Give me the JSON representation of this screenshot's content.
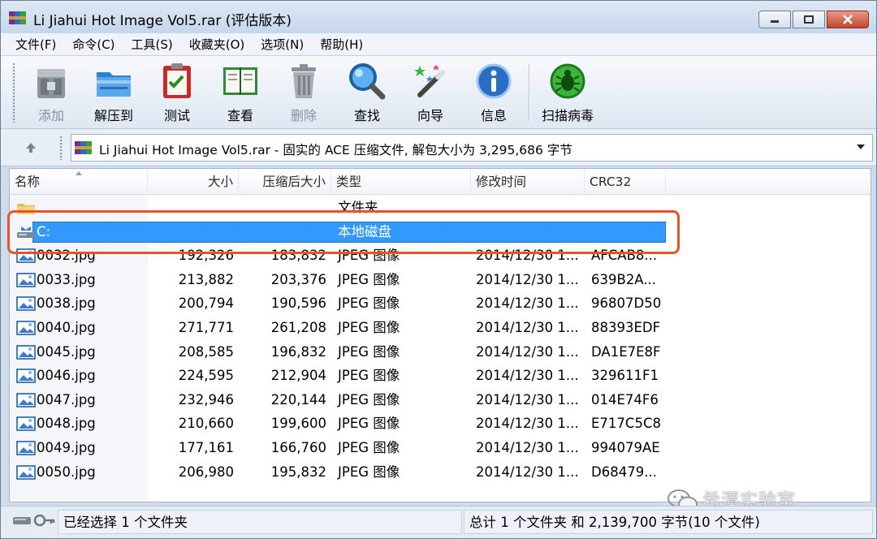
{
  "window": {
    "title": "Li Jiahui Hot Image Vol5.rar (评估版本)",
    "controls": {
      "minimize": "minimize",
      "maximize": "maximize",
      "close": "close"
    }
  },
  "menu": [
    {
      "label": "文件(F)"
    },
    {
      "label": "命令(C)"
    },
    {
      "label": "工具(S)"
    },
    {
      "label": "收藏夹(O)"
    },
    {
      "label": "选项(N)"
    },
    {
      "label": "帮助(H)"
    }
  ],
  "toolbar": [
    {
      "id": "add",
      "label": "添加",
      "icon": "archive-add-icon",
      "disabled": true
    },
    {
      "id": "extract",
      "label": "解压到",
      "icon": "folder-extract-icon",
      "disabled": false
    },
    {
      "id": "test",
      "label": "测试",
      "icon": "test-clipboard-icon",
      "disabled": false
    },
    {
      "id": "view",
      "label": "查看",
      "icon": "book-view-icon",
      "disabled": false
    },
    {
      "id": "delete",
      "label": "删除",
      "icon": "trash-icon",
      "disabled": true
    },
    {
      "id": "find",
      "label": "查找",
      "icon": "magnifier-icon",
      "disabled": false
    },
    {
      "id": "wizard",
      "label": "向导",
      "icon": "wand-icon",
      "disabled": false
    },
    {
      "id": "info",
      "label": "信息",
      "icon": "info-icon",
      "disabled": false
    },
    {
      "id": "scan",
      "label": "扫描病毒",
      "icon": "bug-scan-icon",
      "disabled": false
    }
  ],
  "address": {
    "text": "Li Jiahui Hot Image Vol5.rar - 固实的 ACE 压缩文件, 解包大小为 3,295,686 字节",
    "up_icon": "arrow-up-icon"
  },
  "columns": {
    "name": "名称",
    "size": "大小",
    "packed": "压缩后大小",
    "type": "类型",
    "modified": "修改时间",
    "crc": "CRC32"
  },
  "rows": [
    {
      "name": "",
      "size": "",
      "packed": "",
      "type": "文件夹",
      "modified": "",
      "crc": "",
      "icon": "folder-icon",
      "selected": false
    },
    {
      "name": "C:",
      "size": "",
      "packed": "",
      "type": "本地磁盘",
      "modified": "",
      "crc": "",
      "icon": "local-disk-icon",
      "selected": true
    },
    {
      "name": "0032.jpg",
      "size": "192,326",
      "packed": "183,832",
      "type": "JPEG 图像",
      "modified": "2014/12/30 1...",
      "crc": "AFCAB8...",
      "icon": "jpeg-icon",
      "selected": false
    },
    {
      "name": "0033.jpg",
      "size": "213,882",
      "packed": "203,376",
      "type": "JPEG 图像",
      "modified": "2014/12/30 1...",
      "crc": "639B2A...",
      "icon": "jpeg-icon",
      "selected": false
    },
    {
      "name": "0038.jpg",
      "size": "200,794",
      "packed": "190,596",
      "type": "JPEG 图像",
      "modified": "2014/12/30 1...",
      "crc": "96807D50",
      "icon": "jpeg-icon",
      "selected": false
    },
    {
      "name": "0040.jpg",
      "size": "271,771",
      "packed": "261,208",
      "type": "JPEG 图像",
      "modified": "2014/12/30 1...",
      "crc": "88393EDF",
      "icon": "jpeg-icon",
      "selected": false
    },
    {
      "name": "0045.jpg",
      "size": "208,585",
      "packed": "196,832",
      "type": "JPEG 图像",
      "modified": "2014/12/30 1...",
      "crc": "DA1E7E8F",
      "icon": "jpeg-icon",
      "selected": false
    },
    {
      "name": "0046.jpg",
      "size": "224,595",
      "packed": "212,904",
      "type": "JPEG 图像",
      "modified": "2014/12/30 1...",
      "crc": "329611F1",
      "icon": "jpeg-icon",
      "selected": false
    },
    {
      "name": "0047.jpg",
      "size": "232,946",
      "packed": "220,144",
      "type": "JPEG 图像",
      "modified": "2014/12/30 1...",
      "crc": "014E74F6",
      "icon": "jpeg-icon",
      "selected": false
    },
    {
      "name": "0048.jpg",
      "size": "210,660",
      "packed": "199,600",
      "type": "JPEG 图像",
      "modified": "2014/12/30 1...",
      "crc": "E717C5C8",
      "icon": "jpeg-icon",
      "selected": false
    },
    {
      "name": "0049.jpg",
      "size": "177,161",
      "packed": "166,760",
      "type": "JPEG 图像",
      "modified": "2014/12/30 1...",
      "crc": "994079AE",
      "icon": "jpeg-icon",
      "selected": false
    },
    {
      "name": "0050.jpg",
      "size": "206,980",
      "packed": "195,832",
      "type": "JPEG 图像",
      "modified": "2014/12/30 1...",
      "crc": "D68479...",
      "icon": "jpeg-icon",
      "selected": false
    }
  ],
  "status": {
    "left": "已经选择 1 个文件夹",
    "right": "总计 1 个文件夹 和 2,139,700 字节(10 个文件)",
    "icons": [
      "drive-icon",
      "key-icon"
    ]
  },
  "watermark": "希潭实验室",
  "colors": {
    "selection": "#3399ff",
    "highlight_outline": "#e8532a",
    "window_frame": "#cfdcec"
  }
}
